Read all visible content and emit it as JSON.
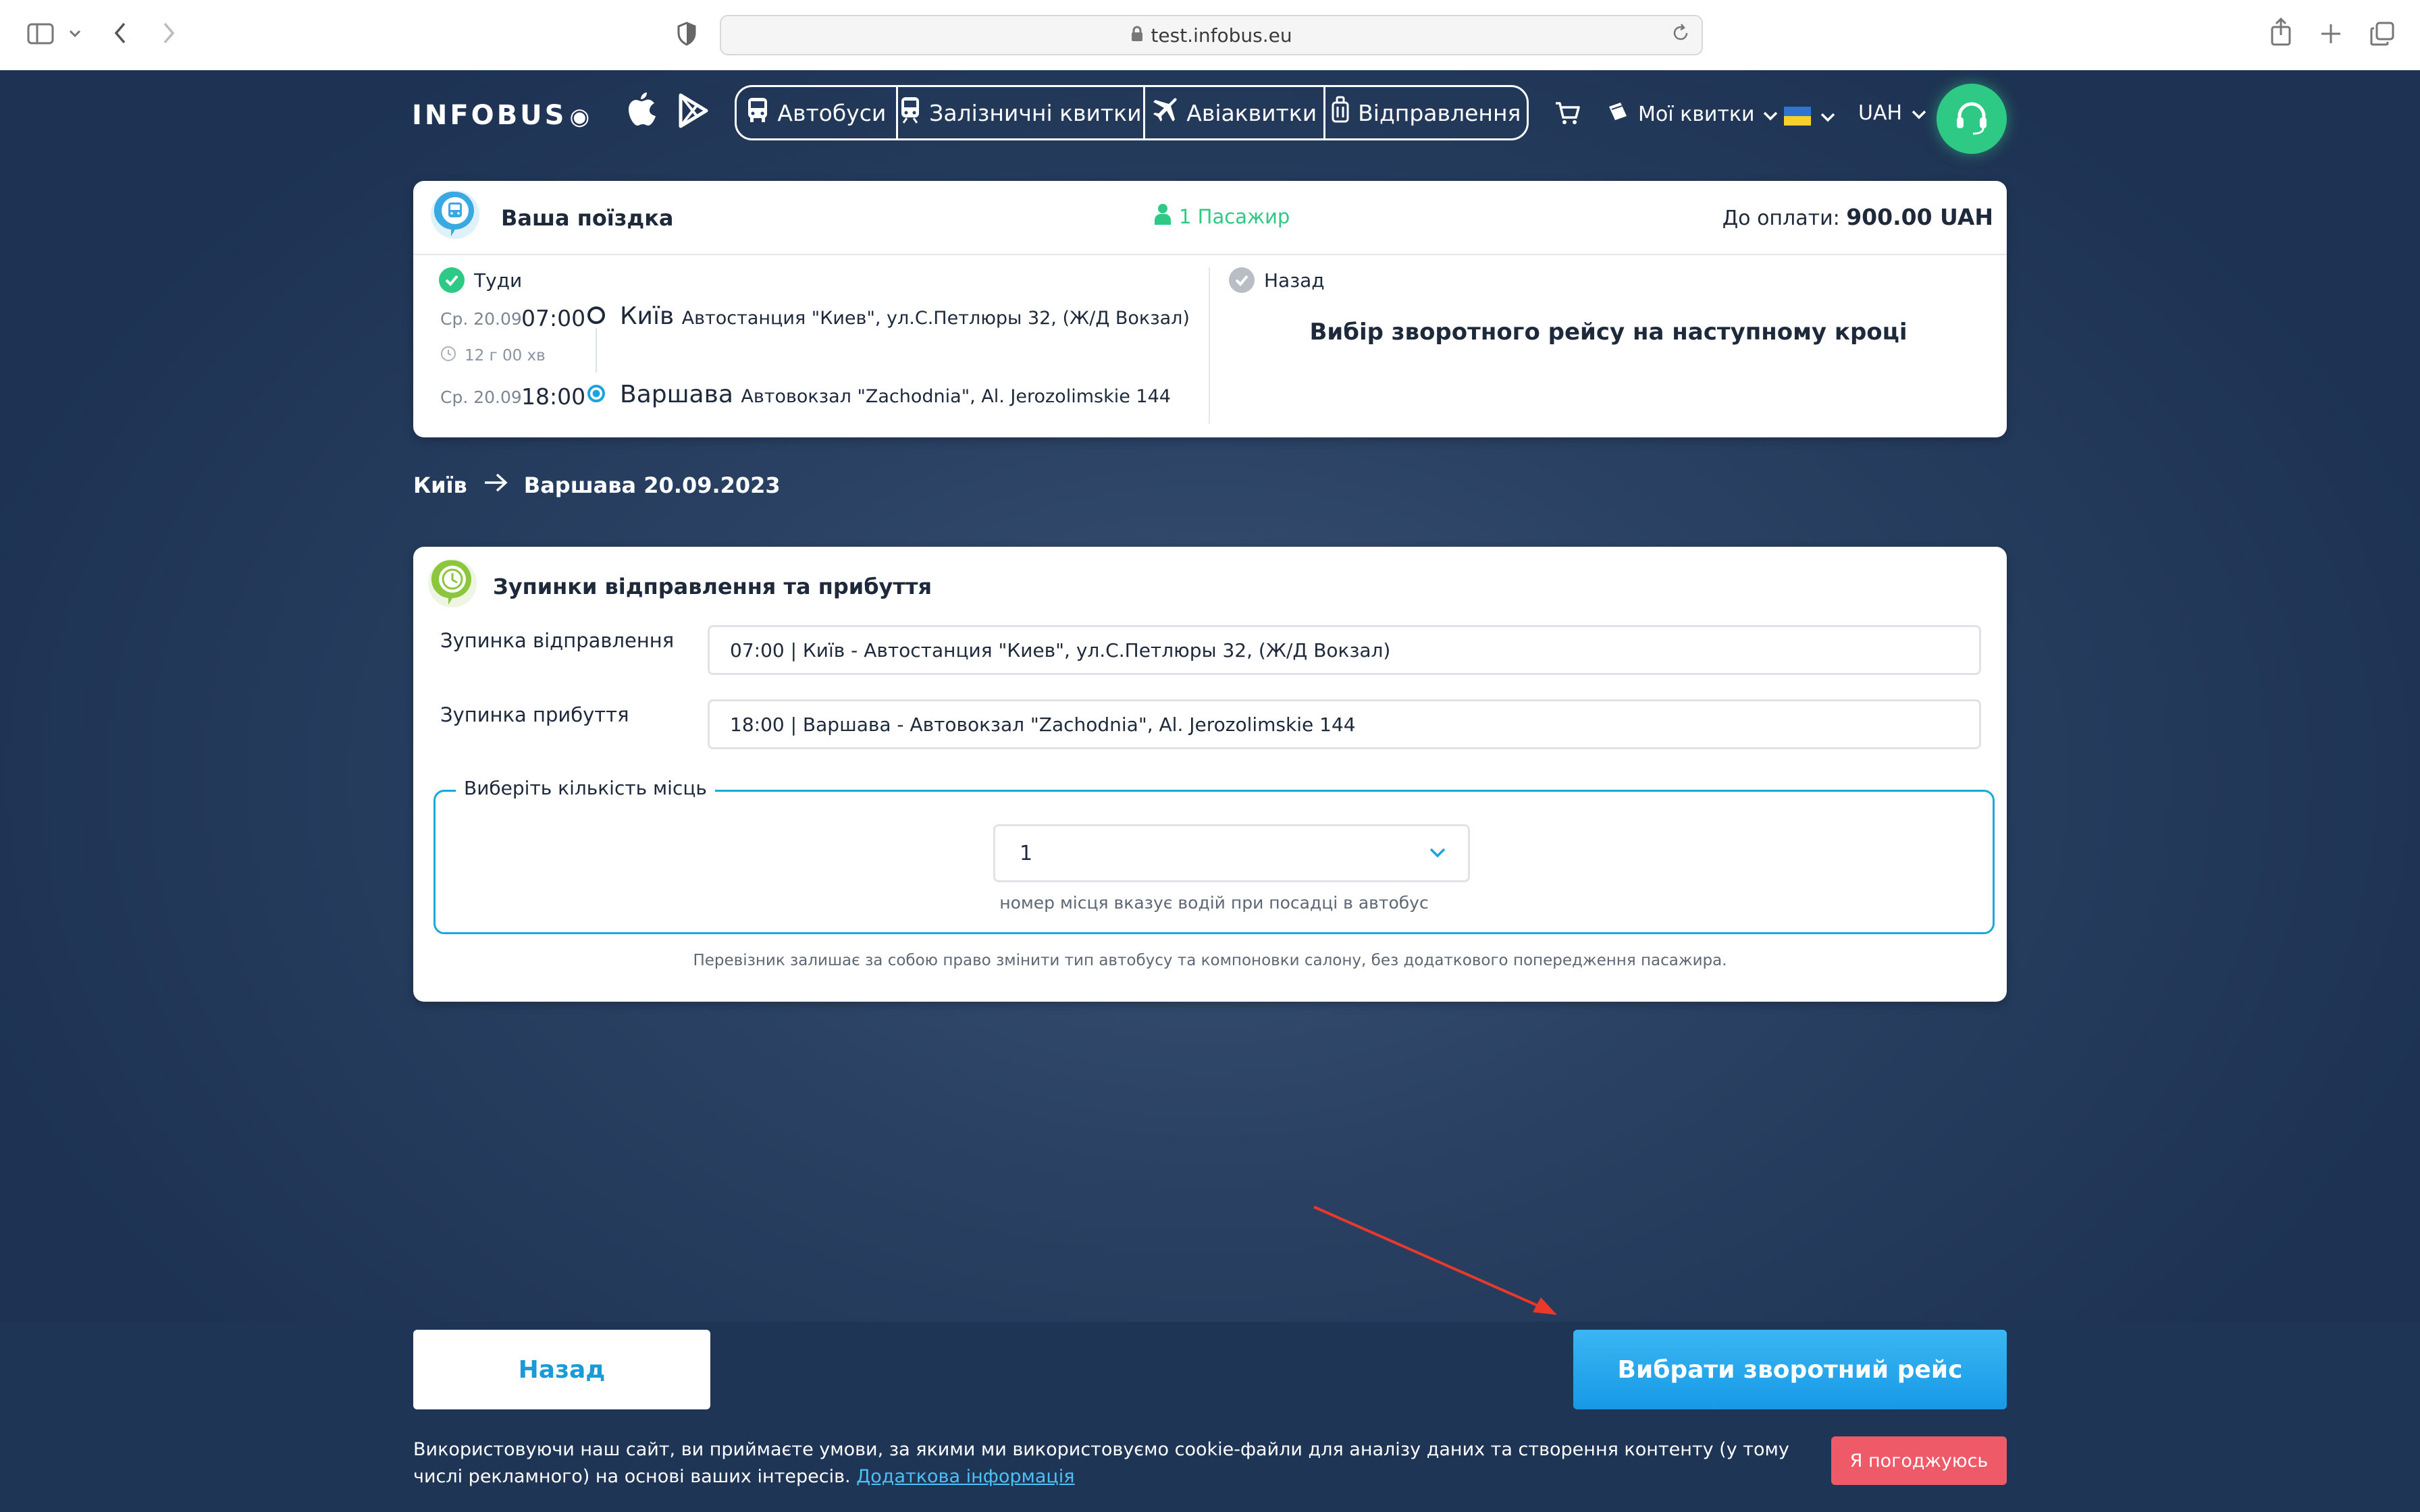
{
  "browser": {
    "url": "test.infobus.eu"
  },
  "header": {
    "logo": "INFOBUS",
    "nav": [
      {
        "label": "Автобуси",
        "icon": "bus-icon"
      },
      {
        "label": "Залізничні квитки",
        "icon": "train-icon"
      },
      {
        "label": "Авіаквитки",
        "icon": "airplane-icon"
      },
      {
        "label": "Відправлення",
        "icon": "luggage-icon"
      }
    ],
    "my_tickets": "Мої квитки",
    "currency": "UAH"
  },
  "trip": {
    "title": "Ваша поїздка",
    "passengers": "1 Пасажир",
    "payment_label": "До оплати:",
    "payment_amount": "900.00 UAH",
    "outbound_label": "Туди",
    "return_label": "Назад",
    "return_message": "Вибір зворотного рейсу на наступному кроці",
    "departure": {
      "date": "Ср. 20.09",
      "time": "07:00",
      "city": "Київ",
      "station": "Автостанция \"Киев\", ул.С.Петлюры 32, (Ж/Д Вокзал)"
    },
    "duration": "12 г 00 хв",
    "arrival": {
      "date": "Ср. 20.09",
      "time": "18:00",
      "city": "Варшава",
      "station": "Автовокзал \"Zachodnia\", Al. Jerozolimskie 144"
    }
  },
  "route": {
    "from": "Київ",
    "to_date": "Варшава 20.09.2023"
  },
  "stops": {
    "title": "Зупинки відправлення та прибуття",
    "departure_label": "Зупинка відправлення",
    "departure_value": "07:00 | Київ - Автостанция \"Киев\", ул.С.Петлюры 32, (Ж/Д Вокзал)",
    "arrival_label": "Зупинка прибуття",
    "arrival_value": "18:00 | Варшава - Автовокзал \"Zachodnia\", Al. Jerozolimskie 144",
    "seats_legend": "Виберіть кількість місць",
    "seats_value": "1",
    "seats_hint": "номер місця вказує водій при посадці в автобус",
    "carrier_note": "Перевізник залишає за собою право змінити тип автобусу та компоновки салону, без додаткового попередження пасажира."
  },
  "actions": {
    "back": "Назад",
    "choose_return": "Вибрати зворотний рейс"
  },
  "cookie": {
    "text": "Використовуючи наш сайт, ви приймаєте умови, за якими ми використовуємо cookie-файли для аналізу даних та створення контенту (у тому числі рекламного) на основі ваших інтересів.",
    "link": "Додаткова інформація",
    "agree": "Я погоджуюсь"
  },
  "colors": {
    "accent_green": "#2fc986",
    "accent_blue": "#1a9bd7",
    "cookie_button": "#ee5a68",
    "annotation_arrow": "#e8392b"
  }
}
